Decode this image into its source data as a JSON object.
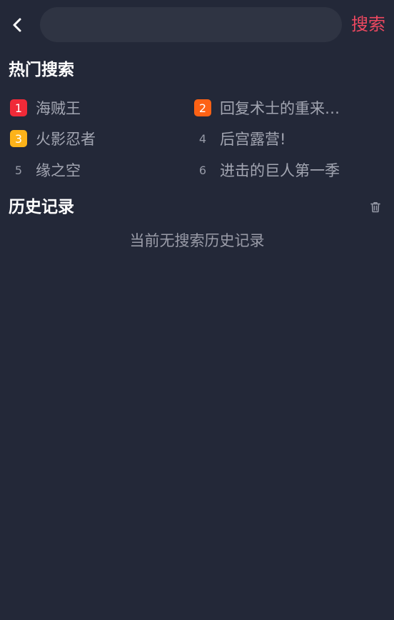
{
  "header": {
    "search_placeholder": "",
    "search_value": "",
    "search_button_label": "搜索"
  },
  "hot_search": {
    "title": "热门搜索",
    "items": [
      {
        "rank": "1",
        "label": "海贼王",
        "badge_color": "#f02a38"
      },
      {
        "rank": "2",
        "label": "回复术士的重来…",
        "badge_color": "#fd6215"
      },
      {
        "rank": "3",
        "label": "火影忍者",
        "badge_color": "#fdb31a"
      },
      {
        "rank": "4",
        "label": "后宫露营!",
        "badge_color": null
      },
      {
        "rank": "5",
        "label": "缘之空",
        "badge_color": null
      },
      {
        "rank": "6",
        "label": "进击的巨人第一季",
        "badge_color": null
      }
    ]
  },
  "history": {
    "title": "历史记录",
    "empty_text": "当前无搜索历史记录"
  },
  "colors": {
    "background": "#232838",
    "search_box": "#2f3443",
    "accent": "#ee4860"
  },
  "icons": {
    "back": "chevron-left-icon",
    "clear_history": "trash-icon"
  }
}
